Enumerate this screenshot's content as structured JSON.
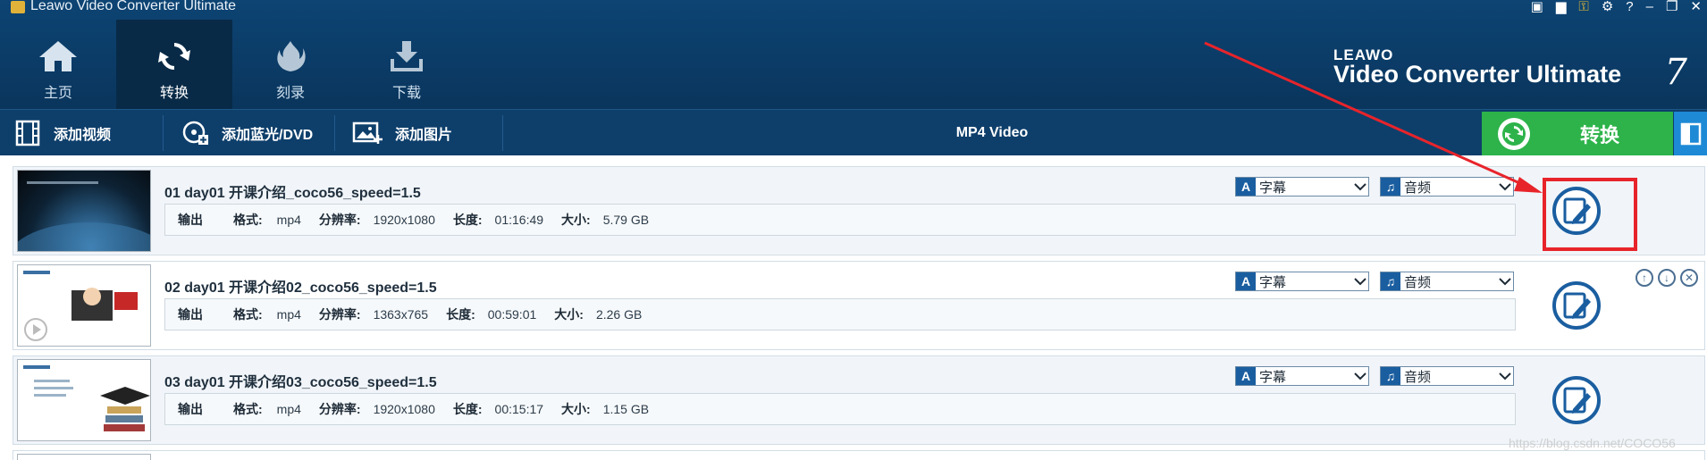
{
  "window": {
    "title": "Leawo Video Converter Ultimate",
    "controls": [
      "monitor-icon",
      "chat-icon",
      "key-icon",
      "gear-icon",
      "help-icon",
      "minimize-icon",
      "restore-icon",
      "close-icon"
    ]
  },
  "nav": {
    "tabs": [
      {
        "label": "主页",
        "icon": "home-icon",
        "active": false
      },
      {
        "label": "转换",
        "icon": "convert-icon",
        "active": true
      },
      {
        "label": "刻录",
        "icon": "burn-icon",
        "active": false
      },
      {
        "label": "下载",
        "icon": "download-icon",
        "active": false
      }
    ]
  },
  "brand": {
    "leawo": "LEAWO",
    "product": "Video Converter Ultimate",
    "version": "7"
  },
  "toolbar": {
    "add_video": "添加视频",
    "add_bluray": "添加蓝光/DVD",
    "add_photo": "添加图片",
    "output_format": "MP4 Video",
    "convert_label": "转换"
  },
  "labels": {
    "output": "输出",
    "format": "格式:",
    "resolution": "分辨率:",
    "duration": "长度:",
    "size": "大小:",
    "subtitle": "字幕",
    "audio": "音频"
  },
  "items": [
    {
      "title": "01 day01 开课介绍_coco56_speed=1.5",
      "format": "mp4",
      "resolution": "1920x1080",
      "duration": "01:16:49",
      "size": "5.79 GB"
    },
    {
      "title": "02 day01 开课介绍02_coco56_speed=1.5",
      "format": "mp4",
      "resolution": "1363x765",
      "duration": "00:59:01",
      "size": "2.26 GB"
    },
    {
      "title": "03 day01 开课介绍03_coco56_speed=1.5",
      "format": "mp4",
      "resolution": "1920x1080",
      "duration": "00:15:17",
      "size": "1.15 GB"
    }
  ],
  "watermark": "https://blog.csdn.net/COCO56",
  "colors": {
    "accent_green": "#2db34a",
    "nav_bg": "#0b3b66",
    "highlight_red": "#e8242b",
    "icon_blue": "#1a5ea0"
  }
}
